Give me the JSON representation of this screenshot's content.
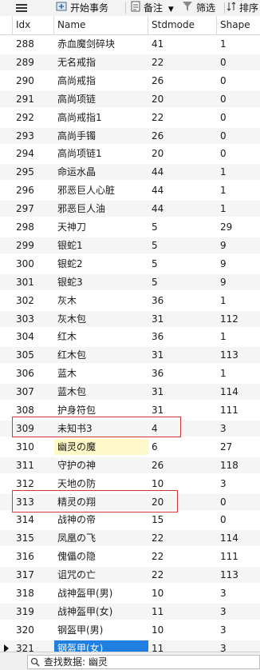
{
  "toolbar": {
    "menu_icon": "hamburger-icon",
    "start_transaction": "开始事务",
    "notes": "备注",
    "filter": "筛选",
    "sort": "排序"
  },
  "table": {
    "columns": [
      "Idx",
      "Name",
      "Stdmode",
      "Shape"
    ],
    "rows": [
      {
        "idx": "288",
        "name": "赤血魔剑碎块",
        "std": "41",
        "shape": "1"
      },
      {
        "idx": "289",
        "name": "无名戒指",
        "std": "22",
        "shape": "0"
      },
      {
        "idx": "290",
        "name": "高尚戒指",
        "std": "26",
        "shape": "0"
      },
      {
        "idx": "291",
        "name": "高尚项链",
        "std": "20",
        "shape": "0"
      },
      {
        "idx": "292",
        "name": "高尚戒指1",
        "std": "22",
        "shape": "0"
      },
      {
        "idx": "293",
        "name": "高尚手镯",
        "std": "26",
        "shape": "0"
      },
      {
        "idx": "294",
        "name": "高尚项链1",
        "std": "20",
        "shape": "0"
      },
      {
        "idx": "295",
        "name": "命运水晶",
        "std": "44",
        "shape": "1"
      },
      {
        "idx": "296",
        "name": "邪恶巨人心脏",
        "std": "44",
        "shape": "1"
      },
      {
        "idx": "297",
        "name": "邪恶巨人油",
        "std": "44",
        "shape": "1"
      },
      {
        "idx": "298",
        "name": "天神刀",
        "std": "5",
        "shape": "29"
      },
      {
        "idx": "299",
        "name": "银蛇1",
        "std": "5",
        "shape": "9"
      },
      {
        "idx": "300",
        "name": "银蛇2",
        "std": "5",
        "shape": "9"
      },
      {
        "idx": "301",
        "name": "银蛇3",
        "std": "5",
        "shape": "9"
      },
      {
        "idx": "302",
        "name": "灰木",
        "std": "36",
        "shape": "1"
      },
      {
        "idx": "303",
        "name": "灰木包",
        "std": "31",
        "shape": "112"
      },
      {
        "idx": "304",
        "name": "红木",
        "std": "36",
        "shape": "1"
      },
      {
        "idx": "305",
        "name": "红木包",
        "std": "31",
        "shape": "113"
      },
      {
        "idx": "306",
        "name": "蓝木",
        "std": "36",
        "shape": "1"
      },
      {
        "idx": "307",
        "name": "蓝木包",
        "std": "31",
        "shape": "114"
      },
      {
        "idx": "308",
        "name": "护身符包",
        "std": "31",
        "shape": "111"
      },
      {
        "idx": "309",
        "name": "未知书3",
        "std": "4",
        "shape": "3"
      },
      {
        "idx": "310",
        "name": "幽灵の魔",
        "std": "6",
        "shape": "27"
      },
      {
        "idx": "311",
        "name": "守护の神",
        "std": "26",
        "shape": "118"
      },
      {
        "idx": "312",
        "name": "天地の防",
        "std": "10",
        "shape": "3"
      },
      {
        "idx": "313",
        "name": "精灵の翔",
        "std": "20",
        "shape": "0"
      },
      {
        "idx": "314",
        "name": "战神の帝",
        "std": "15",
        "shape": "0"
      },
      {
        "idx": "315",
        "name": "凤凰の飞",
        "std": "22",
        "shape": "114"
      },
      {
        "idx": "316",
        "name": "傀儡の隐",
        "std": "22",
        "shape": "111"
      },
      {
        "idx": "317",
        "name": "诅咒の亡",
        "std": "22",
        "shape": "113"
      },
      {
        "idx": "318",
        "name": "战神盔甲(男)",
        "std": "10",
        "shape": "3"
      },
      {
        "idx": "319",
        "name": "战神盔甲(女)",
        "std": "11",
        "shape": "3"
      },
      {
        "idx": "320",
        "name": "钢盔甲(男)",
        "std": "10",
        "shape": "3"
      },
      {
        "idx": "321",
        "name": "钢盔甲(女)",
        "std": "11",
        "shape": "3"
      }
    ],
    "highlighted_rows": [
      "310",
      "314"
    ],
    "selected_row": "321"
  },
  "search": {
    "value": "查找数据: 幽灵"
  },
  "colors": {
    "accent": "#1e7fe0",
    "highlight_box": "#d2383b",
    "match_fill": "#fff8c8"
  }
}
